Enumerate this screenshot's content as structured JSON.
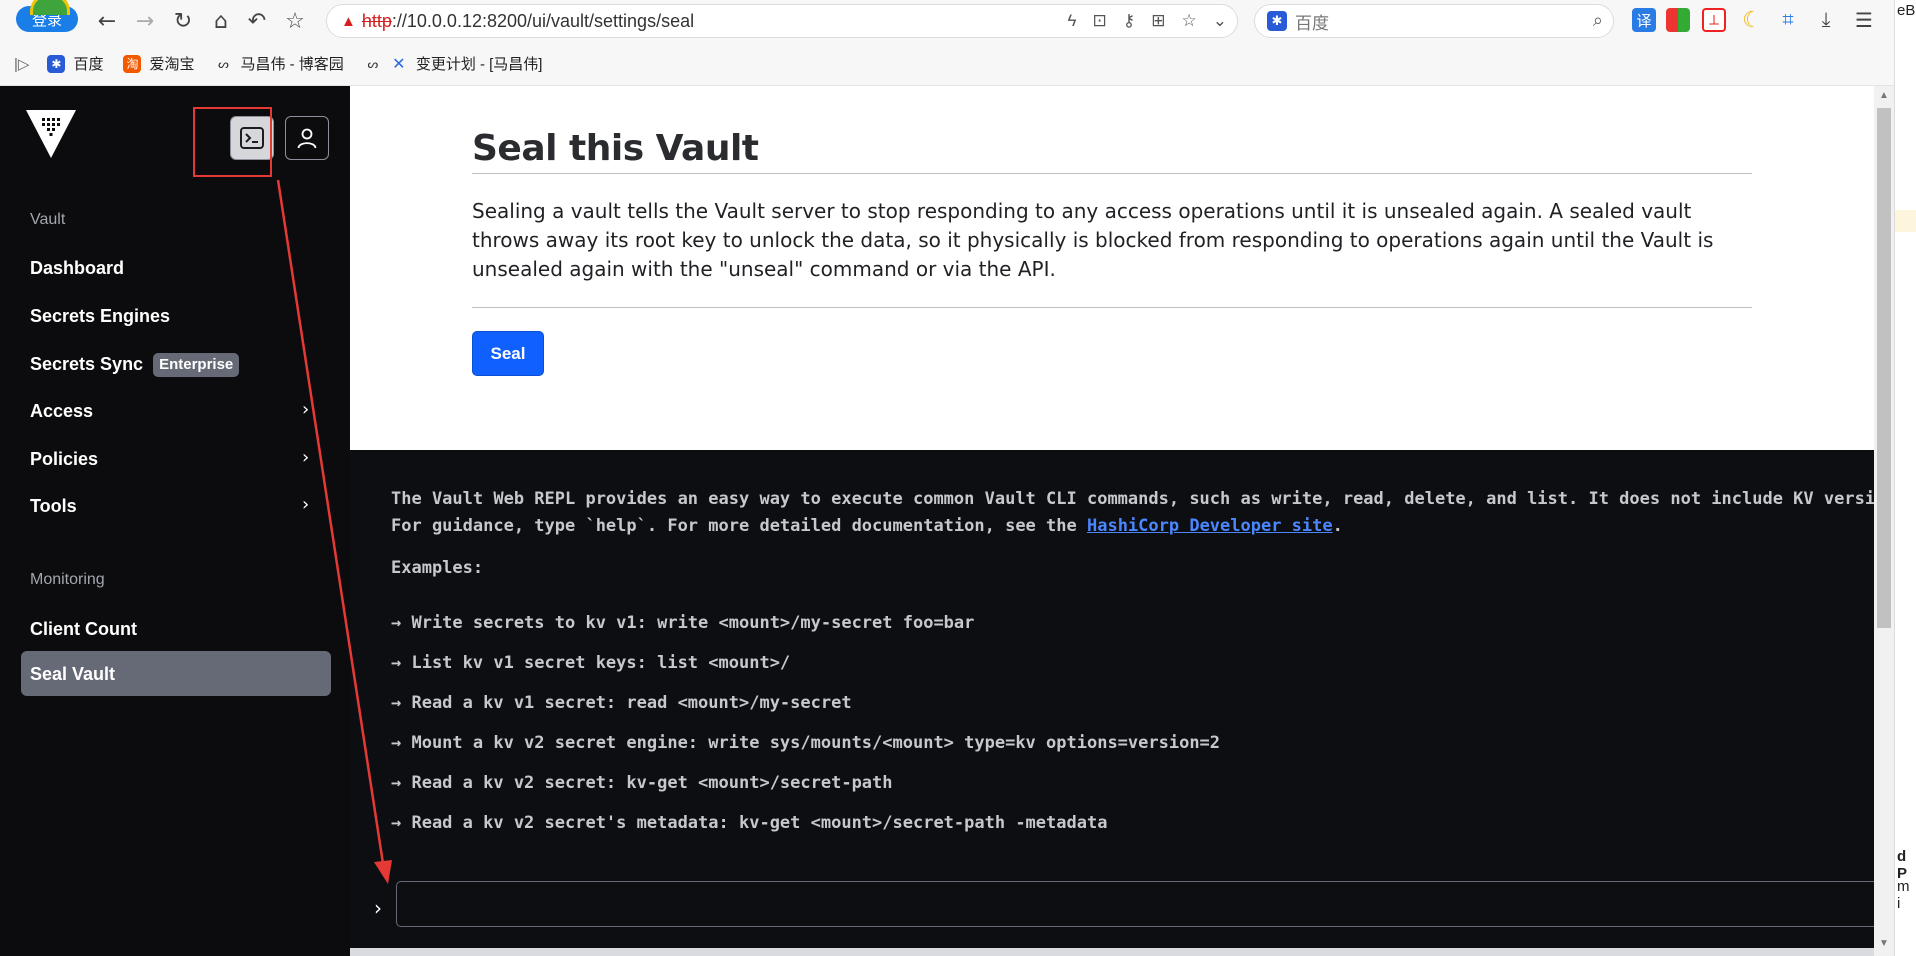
{
  "browser": {
    "login_label": "登录",
    "url_http": "http",
    "url_rest": "://10.0.0.12:8200/ui/vault/settings/seal",
    "search_placeholder": "百度",
    "bookmarks": [
      "百度",
      "爱淘宝",
      "马昌伟 - 博客园",
      "变更计划 - [马昌伟]"
    ]
  },
  "sidebar": {
    "section_vault": "Vault",
    "items": [
      "Dashboard",
      "Secrets Engines",
      "Secrets Sync",
      "Access",
      "Policies",
      "Tools"
    ],
    "enterprise_badge": "Enterprise",
    "section_monitoring": "Monitoring",
    "monitoring_items": [
      "Client Count",
      "Seal Vault"
    ]
  },
  "main": {
    "title": "Seal this Vault",
    "description": "Sealing a vault tells the Vault server to stop responding to any access operations until it is unsealed again. A sealed vault throws away its root key to unlock the data, so it physically is blocked from responding to operations again until the Vault is unsealed again with the \"unseal\" command or via the API.",
    "seal_button": "Seal"
  },
  "repl": {
    "intro_line1": "The Vault Web REPL provides an easy way to execute common Vault CLI commands, such as write, read, delete, and list. It does not include KV versi",
    "intro_line2_prefix": "For guidance, type `help`. For more detailed documentation, see the ",
    "intro_link": "HashiCorp Developer site",
    "intro_line2_suffix": ".",
    "examples_label": "Examples:",
    "examples": [
      "→ Write secrets to kv v1: write <mount>/my-secret foo=bar",
      "→ List kv v1 secret keys: list <mount>/",
      "→ Read a kv v1 secret: read <mount>/my-secret",
      "→ Mount a kv v2 secret engine: write sys/mounts/<mount> type=kv options=version=2",
      "→ Read a kv v2 secret: kv-get <mount>/secret-path",
      "→ Read a kv v2 secret's metadata: kv-get <mount>/secret-path -metadata"
    ],
    "prompt": "›"
  },
  "right_strip": [
    "eBc",
    "d P",
    "m i"
  ]
}
